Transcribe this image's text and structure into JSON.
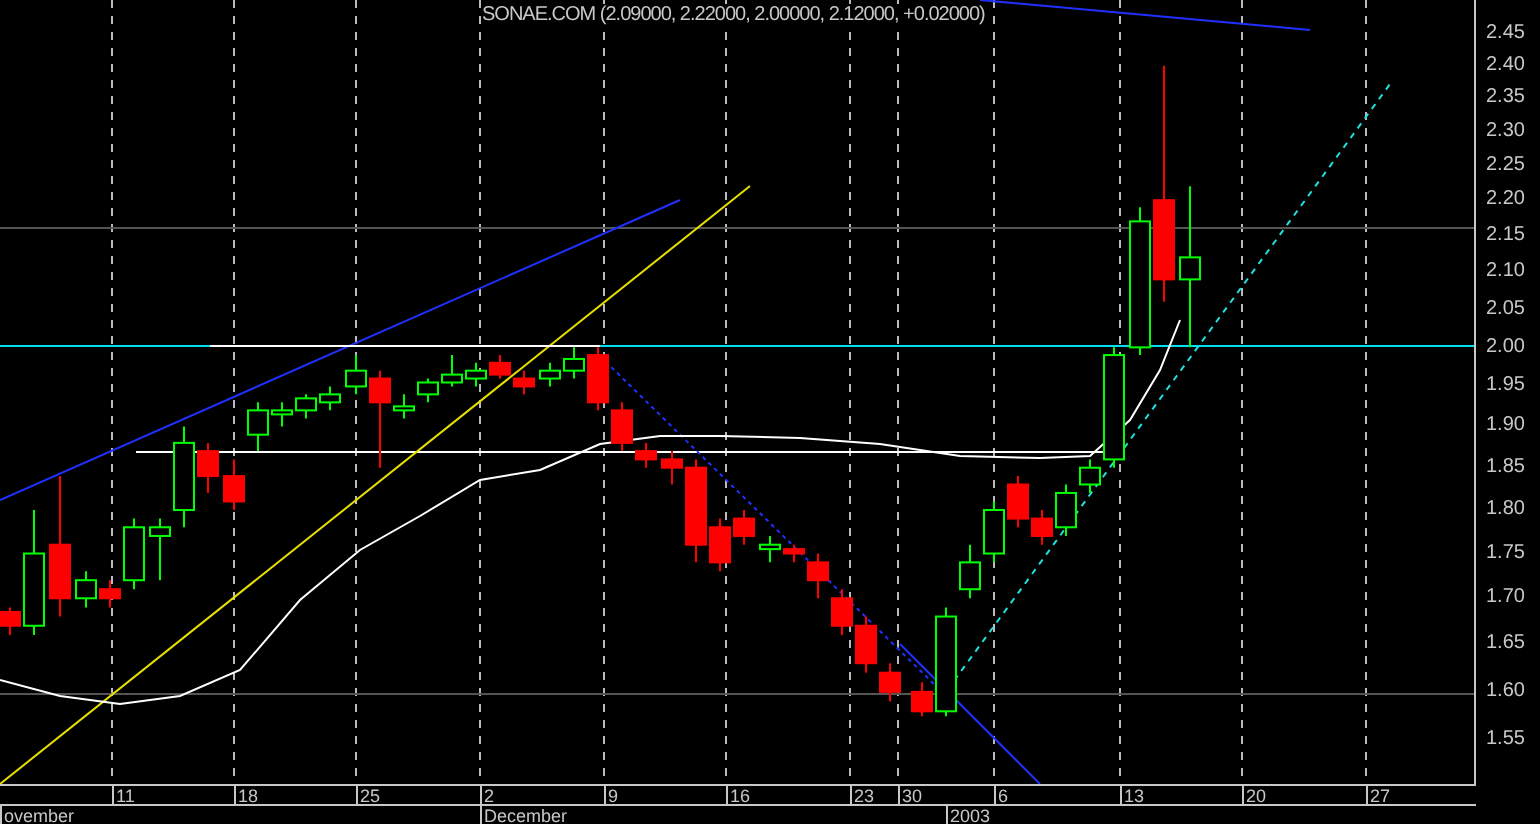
{
  "title": "SONAE.COM (2.09000, 2.22000, 2.00000, 2.12000, +0.02000)",
  "y_ticks": [
    "2.45",
    "2.40",
    "2.35",
    "2.30",
    "2.25",
    "2.20",
    "2.15",
    "2.10",
    "2.05",
    "2.00",
    "1.95",
    "1.90",
    "1.85",
    "1.80",
    "1.75",
    "1.70",
    "1.65",
    "1.60",
    "1.55"
  ],
  "x_ticks": [
    "11",
    "18",
    "25",
    "2",
    "9",
    "16",
    "23",
    "30",
    "6",
    "13",
    "20",
    "27"
  ],
  "months": [
    "ovember",
    "December",
    "2003"
  ]
}
